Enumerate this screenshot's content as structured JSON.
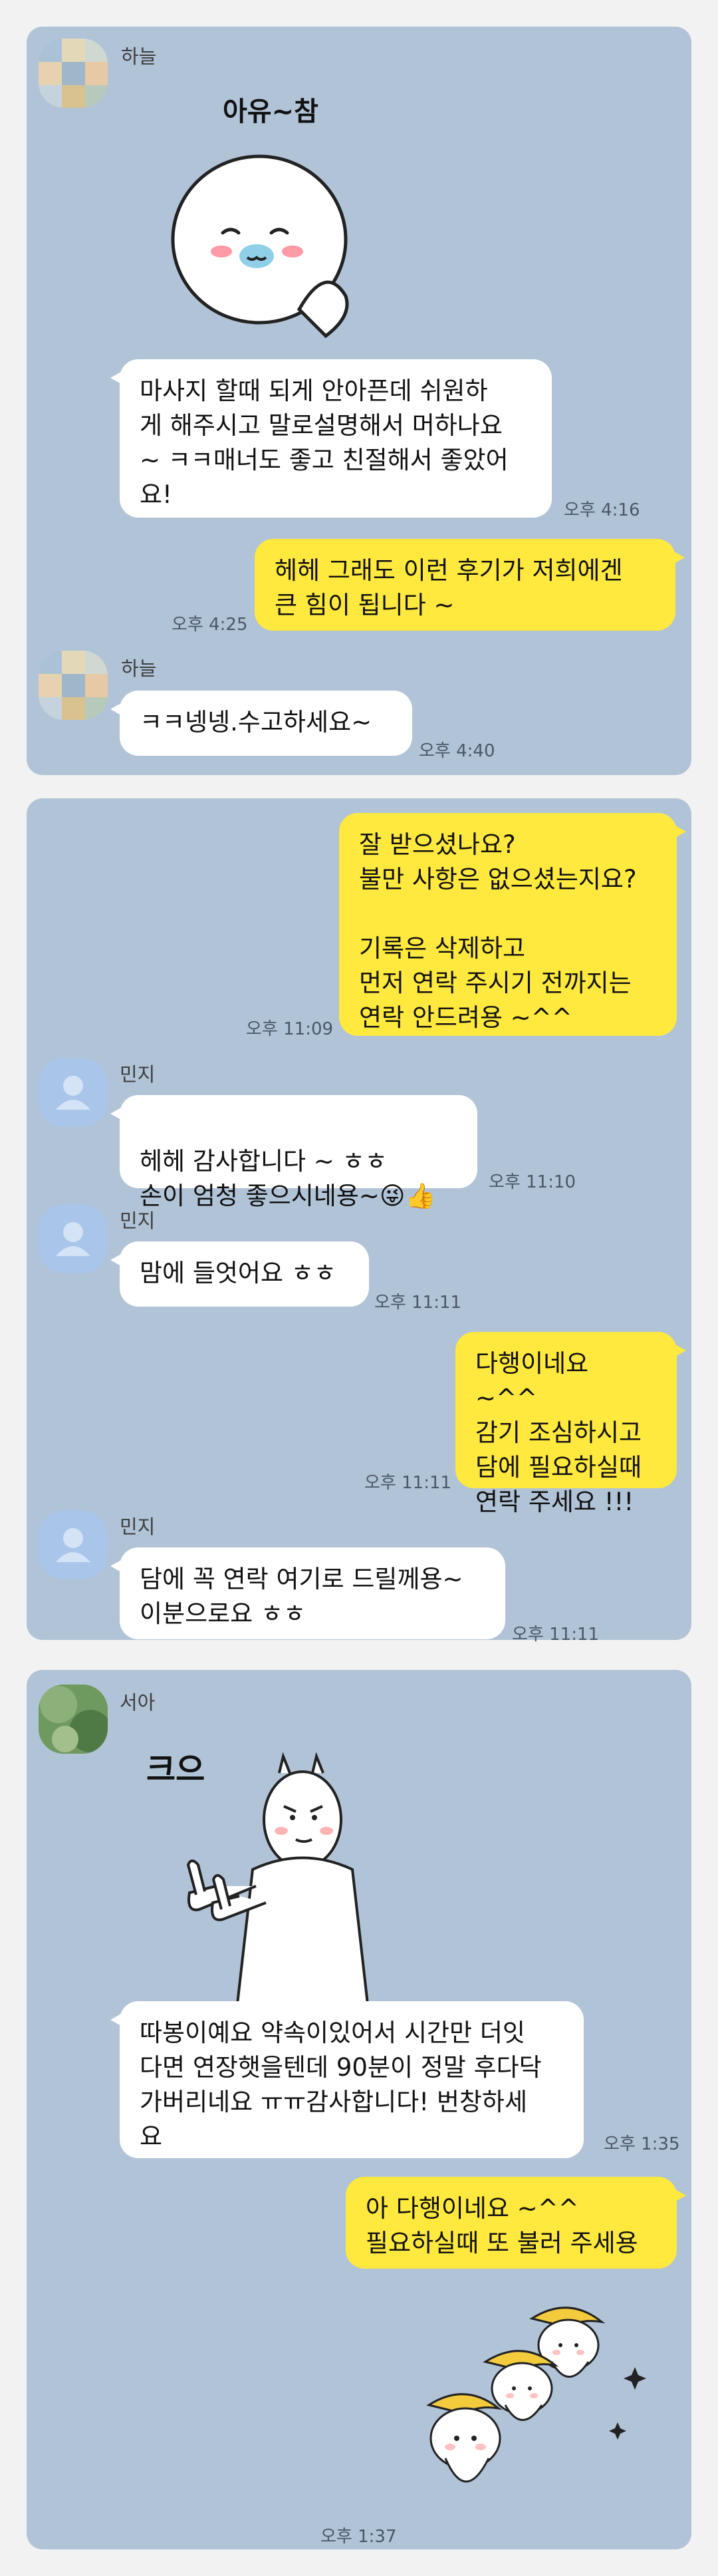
{
  "colors": {
    "chat_bg": "#b1c3d7",
    "incoming_bubble": "#ffffff",
    "outgoing_bubble": "#ffe93e",
    "page_bg": "#f2f2f2"
  },
  "panel1": {
    "sender": "하늘",
    "sticker_text": "아유~참",
    "msg1": "마사지 할때 되게 안아픈데 쉬원하\n게 해주시고 말로설명해서 머하나요\n~ ㅋㅋ매너도 좋고 친절해서 좋았어\n요!",
    "time1": "오후 4:16",
    "reply1": "헤헤 그래도 이런 후기가 저희에겐\n큰 힘이 됩니다 ~",
    "reply1_time": "오후 4:25",
    "sender2": "하늘",
    "msg2": "ㅋㅋ넹넹.수고하세요~",
    "time2": "오후 4:40"
  },
  "panel2": {
    "out1": "잘 받으셨나요?\n불만 사항은 없으셨는지요?\n\n기록은 삭제하고\n먼저 연락 주시기 전까지는\n연락 안드려용 ~^^",
    "out1_time": "오후 11:09",
    "sender": "민지",
    "in1": "헤헤 감사합니다 ~ ㅎㅎ\n손이 엄청 좋으시네용~",
    "in1_emoji": "😜👍",
    "in1_time": "오후 11:10",
    "sender2": "민지",
    "in2": "맘에 들엇어요 ㅎㅎ",
    "in2_time": "오후 11:11",
    "out2": "다행이네요 ~^^\n감기 조심하시고\n담에 필요하실때\n연락 주세요 !!!",
    "out2_time": "오후 11:11",
    "sender3": "민지",
    "in3": "담에 꼭 연락 여기로 드릴께용~\n이분으로요 ㅎㅎ",
    "in3_time": "오후 11:11"
  },
  "panel3": {
    "sender": "서아",
    "sticker_text": "크으",
    "msg": "따봉이예요 약속이있어서 시간만 더잇\n다면 연장햇을텐데 90분이 정말 후다닥\n가버리네요 ㅠㅠ감사합니다! 번창하세\n요",
    "msg_time": "오후 1:35",
    "reply": "아 다행이네요 ~^^\n필요하실때 또 불러 주세용",
    "sticker_time": "오후 1:37"
  }
}
